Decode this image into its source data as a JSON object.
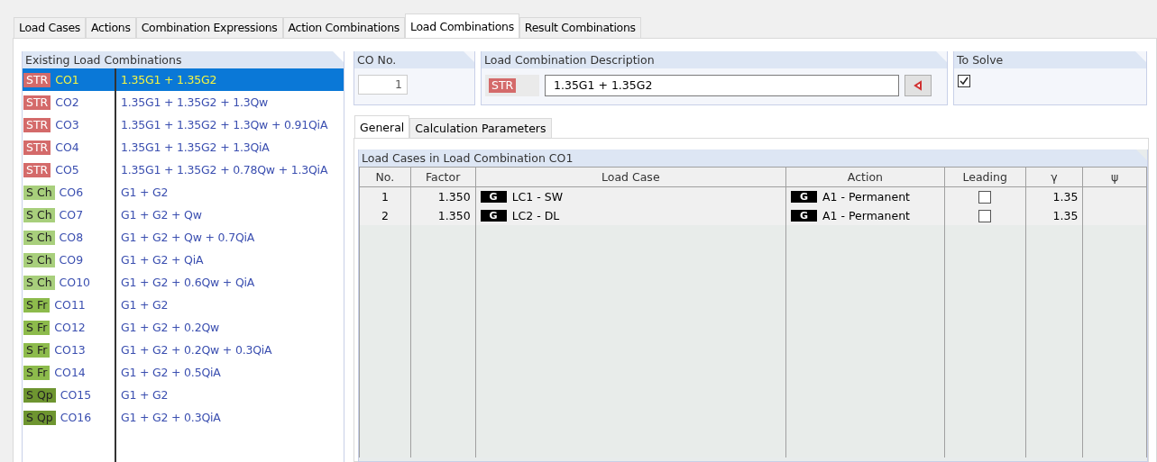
{
  "tabs": [
    {
      "label": "Load Cases",
      "selected": false
    },
    {
      "label": "Actions",
      "selected": false
    },
    {
      "label": "Combination Expressions",
      "selected": false
    },
    {
      "label": "Action Combinations",
      "selected": false
    },
    {
      "label": "Load Combinations",
      "selected": true
    },
    {
      "label": "Result Combinations",
      "selected": false
    }
  ],
  "existing": {
    "title": "Existing Load Combinations",
    "items": [
      {
        "badge": "STR",
        "color": "#d46a6a",
        "name": "CO1",
        "expression": "1.35G1 + 1.35G2",
        "selected": true
      },
      {
        "badge": "STR",
        "color": "#d46a6a",
        "name": "CO2",
        "expression": "1.35G1 + 1.35G2 + 1.3Qw",
        "selected": false
      },
      {
        "badge": "STR",
        "color": "#d46a6a",
        "name": "CO3",
        "expression": "1.35G1 + 1.35G2 + 1.3Qw + 0.91QiA",
        "selected": false
      },
      {
        "badge": "STR",
        "color": "#d46a6a",
        "name": "CO4",
        "expression": "1.35G1 + 1.35G2 + 1.3QiA",
        "selected": false
      },
      {
        "badge": "STR",
        "color": "#d46a6a",
        "name": "CO5",
        "expression": "1.35G1 + 1.35G2 + 0.78Qw + 1.3QiA",
        "selected": false
      },
      {
        "badge": "S Ch",
        "color": "#a8cf7c",
        "name": "CO6",
        "expression": "G1 + G2",
        "selected": false
      },
      {
        "badge": "S Ch",
        "color": "#a8cf7c",
        "name": "CO7",
        "expression": "G1 + G2 + Qw",
        "selected": false
      },
      {
        "badge": "S Ch",
        "color": "#a8cf7c",
        "name": "CO8",
        "expression": "G1 + G2 + Qw + 0.7QiA",
        "selected": false
      },
      {
        "badge": "S Ch",
        "color": "#a8cf7c",
        "name": "CO9",
        "expression": "G1 + G2 + QiA",
        "selected": false
      },
      {
        "badge": "S Ch",
        "color": "#a8cf7c",
        "name": "CO10",
        "expression": "G1 + G2 + 0.6Qw + QiA",
        "selected": false
      },
      {
        "badge": "S Fr",
        "color": "#8dbb4c",
        "name": "CO11",
        "expression": "G1 + G2",
        "selected": false
      },
      {
        "badge": "S Fr",
        "color": "#8dbb4c",
        "name": "CO12",
        "expression": "G1 + G2 + 0.2Qw",
        "selected": false
      },
      {
        "badge": "S Fr",
        "color": "#8dbb4c",
        "name": "CO13",
        "expression": "G1 + G2 + 0.2Qw + 0.3QiA",
        "selected": false
      },
      {
        "badge": "S Fr",
        "color": "#8dbb4c",
        "name": "CO14",
        "expression": "G1 + G2 + 0.5QiA",
        "selected": false
      },
      {
        "badge": "S Qp",
        "color": "#6e9530",
        "name": "CO15",
        "expression": "G1 + G2",
        "selected": false
      },
      {
        "badge": "S Qp",
        "color": "#6e9530",
        "name": "CO16",
        "expression": "G1 + G2 + 0.3QiA",
        "selected": false
      }
    ]
  },
  "co_no": {
    "title": "CO No.",
    "value": "1"
  },
  "description": {
    "title": "Load Combination Description",
    "badge": "STR",
    "value": "1.35G1 + 1.35G2"
  },
  "to_solve": {
    "title": "To Solve",
    "checked": true
  },
  "inner_tabs": [
    {
      "label": "General",
      "selected": true
    },
    {
      "label": "Calculation Parameters",
      "selected": false
    }
  ],
  "table": {
    "title": "Load Cases in Load Combination CO1",
    "columns": [
      "No.",
      "Factor",
      "Load Case",
      "Action",
      "Leading",
      "γ",
      "ψ"
    ],
    "rows": [
      {
        "no": "1",
        "factor": "1.350",
        "lc_badge": "G",
        "load_case": "LC1 - SW",
        "action_badge": "G",
        "action": "A1 - Permanent",
        "leading": false,
        "gamma": "1.35"
      },
      {
        "no": "2",
        "factor": "1.350",
        "lc_badge": "G",
        "load_case": "LC2 - DL",
        "action_badge": "G",
        "action": "A1 - Permanent",
        "leading": false,
        "gamma": "1.35"
      }
    ]
  }
}
